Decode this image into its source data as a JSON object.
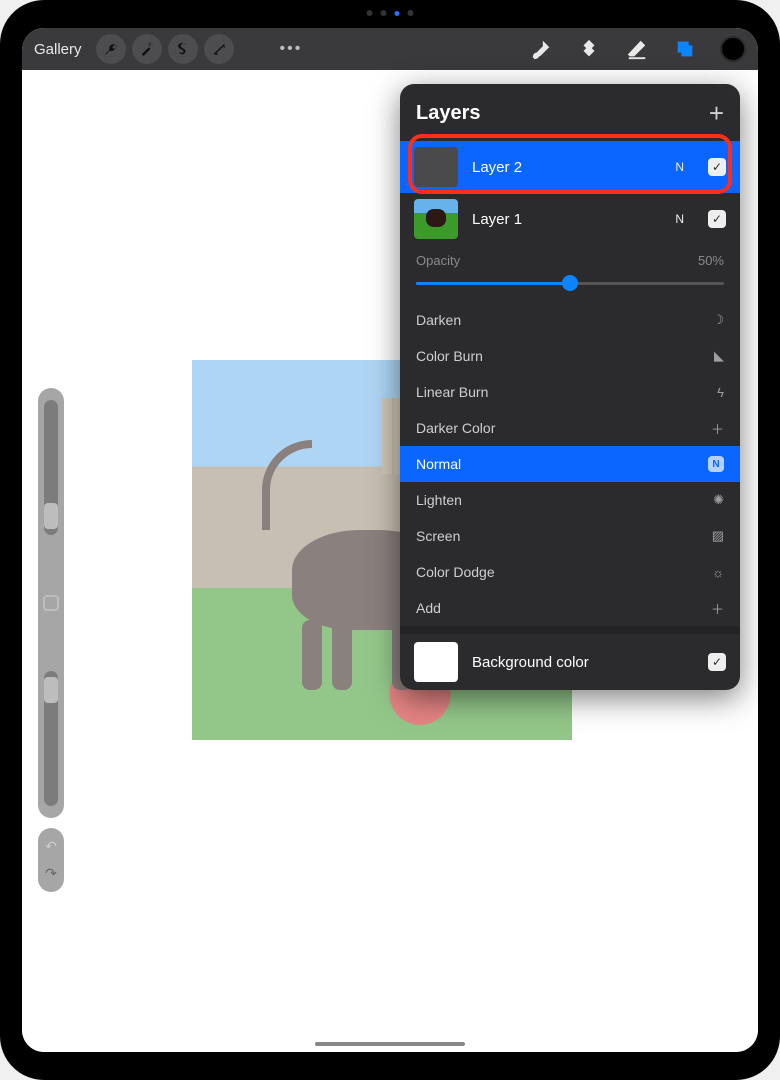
{
  "topbar": {
    "gallery_label": "Gallery",
    "ellipsis": "•••"
  },
  "layers_panel": {
    "title": "Layers",
    "add_symbol": "+",
    "layers": [
      {
        "name": "Layer 2",
        "mode": "N",
        "checked": "✓",
        "selected": true
      },
      {
        "name": "Layer 1",
        "mode": "N",
        "checked": "✓",
        "selected": false
      }
    ],
    "opacity_label": "Opacity",
    "opacity_value": "50%",
    "opacity_percent": 50,
    "blend_modes": [
      {
        "name": "Darken",
        "icon": "☽"
      },
      {
        "name": "Color Burn",
        "icon": "◣"
      },
      {
        "name": "Linear Burn",
        "icon": "ϟ"
      },
      {
        "name": "Darker Color",
        "icon": "＋"
      },
      {
        "name": "Normal",
        "icon": "N",
        "selected": true
      },
      {
        "name": "Lighten",
        "icon": "✺"
      },
      {
        "name": "Screen",
        "icon": "▨"
      },
      {
        "name": "Color Dodge",
        "icon": "☼"
      },
      {
        "name": "Add",
        "icon": "＋"
      }
    ],
    "background_label": "Background color",
    "background_checked": "✓"
  },
  "undo_symbol": "↶",
  "redo_symbol": "↷"
}
